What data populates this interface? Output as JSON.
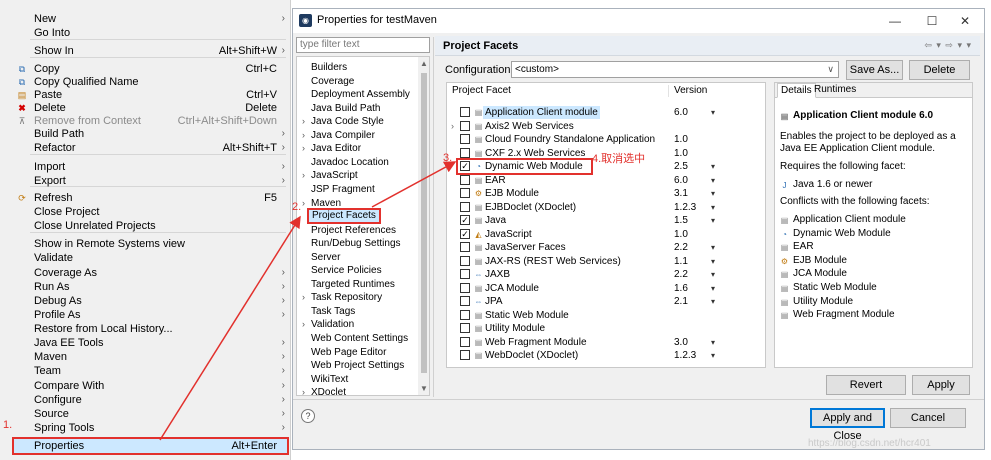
{
  "context_menu": {
    "items": [
      {
        "label": "New",
        "shortcut": "",
        "submenu": true,
        "icon": "",
        "disabled": false
      },
      {
        "label": "Go Into",
        "shortcut": "",
        "submenu": false,
        "icon": "",
        "disabled": false
      },
      {
        "label": "Show In",
        "shortcut": "Alt+Shift+W",
        "submenu": true,
        "icon": "",
        "disabled": false
      },
      {
        "label": "Copy",
        "shortcut": "Ctrl+C",
        "submenu": false,
        "icon": "copy-icon",
        "disabled": false
      },
      {
        "label": "Copy Qualified Name",
        "shortcut": "",
        "submenu": false,
        "icon": "copy-qualified-icon",
        "disabled": false
      },
      {
        "label": "Paste",
        "shortcut": "Ctrl+V",
        "submenu": false,
        "icon": "paste-icon",
        "disabled": false
      },
      {
        "label": "Delete",
        "shortcut": "Delete",
        "submenu": false,
        "icon": "delete-icon",
        "disabled": false
      },
      {
        "label": "Remove from Context",
        "shortcut": "Ctrl+Alt+Shift+Down",
        "submenu": false,
        "icon": "remove-context-icon",
        "disabled": true
      },
      {
        "label": "Build Path",
        "shortcut": "",
        "submenu": true,
        "icon": "",
        "disabled": false
      },
      {
        "label": "Refactor",
        "shortcut": "Alt+Shift+T",
        "submenu": true,
        "icon": "",
        "disabled": false
      },
      {
        "label": "Import",
        "shortcut": "",
        "submenu": true,
        "icon": "",
        "disabled": false
      },
      {
        "label": "Export",
        "shortcut": "",
        "submenu": true,
        "icon": "",
        "disabled": false
      },
      {
        "label": "Refresh",
        "shortcut": "F5",
        "submenu": false,
        "icon": "refresh-icon",
        "disabled": false
      },
      {
        "label": "Close Project",
        "shortcut": "",
        "submenu": false,
        "icon": "",
        "disabled": false
      },
      {
        "label": "Close Unrelated Projects",
        "shortcut": "",
        "submenu": false,
        "icon": "",
        "disabled": false
      },
      {
        "label": "Show in Remote Systems view",
        "shortcut": "",
        "submenu": false,
        "icon": "",
        "disabled": false
      },
      {
        "label": "Validate",
        "shortcut": "",
        "submenu": false,
        "icon": "",
        "disabled": false
      },
      {
        "label": "Coverage As",
        "shortcut": "",
        "submenu": true,
        "icon": "",
        "disabled": false
      },
      {
        "label": "Run As",
        "shortcut": "",
        "submenu": true,
        "icon": "",
        "disabled": false
      },
      {
        "label": "Debug As",
        "shortcut": "",
        "submenu": true,
        "icon": "",
        "disabled": false
      },
      {
        "label": "Profile As",
        "shortcut": "",
        "submenu": true,
        "icon": "",
        "disabled": false
      },
      {
        "label": "Restore from Local History...",
        "shortcut": "",
        "submenu": false,
        "icon": "",
        "disabled": false
      },
      {
        "label": "Java EE Tools",
        "shortcut": "",
        "submenu": true,
        "icon": "",
        "disabled": false
      },
      {
        "label": "Maven",
        "shortcut": "",
        "submenu": true,
        "icon": "",
        "disabled": false
      },
      {
        "label": "Team",
        "shortcut": "",
        "submenu": true,
        "icon": "",
        "disabled": false
      },
      {
        "label": "Compare With",
        "shortcut": "",
        "submenu": true,
        "icon": "",
        "disabled": false
      },
      {
        "label": "Configure",
        "shortcut": "",
        "submenu": true,
        "icon": "",
        "disabled": false
      },
      {
        "label": "Source",
        "shortcut": "",
        "submenu": true,
        "icon": "",
        "disabled": false
      },
      {
        "label": "Spring Tools",
        "shortcut": "",
        "submenu": true,
        "icon": "",
        "disabled": false
      },
      {
        "label": "Properties",
        "shortcut": "Alt+Enter",
        "submenu": false,
        "icon": "",
        "disabled": false
      }
    ]
  },
  "annotations": {
    "step1": "1.",
    "step2": "2.",
    "step3": "3.",
    "step4": "4.取消选中",
    "color": "#e2312d"
  },
  "dialog": {
    "title": "Properties for testMaven",
    "filter_placeholder": "type filter text",
    "tree": [
      {
        "label": "Builders",
        "expandable": false
      },
      {
        "label": "Coverage",
        "expandable": false
      },
      {
        "label": "Deployment Assembly",
        "expandable": false
      },
      {
        "label": "Java Build Path",
        "expandable": false
      },
      {
        "label": "Java Code Style",
        "expandable": true
      },
      {
        "label": "Java Compiler",
        "expandable": true
      },
      {
        "label": "Java Editor",
        "expandable": true
      },
      {
        "label": "Javadoc Location",
        "expandable": false
      },
      {
        "label": "JavaScript",
        "expandable": true
      },
      {
        "label": "JSP Fragment",
        "expandable": false
      },
      {
        "label": "Maven",
        "expandable": true
      },
      {
        "label": "Project Facets",
        "expandable": false
      },
      {
        "label": "Project References",
        "expandable": false
      },
      {
        "label": "Run/Debug Settings",
        "expandable": false
      },
      {
        "label": "Server",
        "expandable": false
      },
      {
        "label": "Service Policies",
        "expandable": false
      },
      {
        "label": "Targeted Runtimes",
        "expandable": false
      },
      {
        "label": "Task Repository",
        "expandable": true
      },
      {
        "label": "Task Tags",
        "expandable": false
      },
      {
        "label": "Validation",
        "expandable": true
      },
      {
        "label": "Web Content Settings",
        "expandable": false
      },
      {
        "label": "Web Page Editor",
        "expandable": false
      },
      {
        "label": "Web Project Settings",
        "expandable": false
      },
      {
        "label": "WikiText",
        "expandable": false
      },
      {
        "label": "XDoclet",
        "expandable": true
      }
    ],
    "page_title": "Project Facets",
    "configuration_label": "Configuration:",
    "configuration_value": "<custom>",
    "save_as": "Save As...",
    "delete": "Delete",
    "facet_col": "Project Facet",
    "version_col": "Version",
    "facets": [
      {
        "name": "Application Client module",
        "version": "6.0",
        "dropdown": true,
        "checked": false,
        "icon": "doc",
        "expandable": false
      },
      {
        "name": "Axis2 Web Services",
        "version": "",
        "dropdown": false,
        "checked": false,
        "icon": "doc",
        "expandable": true
      },
      {
        "name": "Cloud Foundry Standalone Application",
        "version": "1.0",
        "dropdown": false,
        "checked": false,
        "icon": "doc",
        "expandable": false
      },
      {
        "name": "CXF 2.x Web Services",
        "version": "1.0",
        "dropdown": false,
        "checked": false,
        "icon": "doc",
        "expandable": false
      },
      {
        "name": "Dynamic Web Module",
        "version": "2.5",
        "dropdown": true,
        "checked": true,
        "icon": "web",
        "expandable": false
      },
      {
        "name": "EAR",
        "version": "6.0",
        "dropdown": true,
        "checked": false,
        "icon": "doc",
        "expandable": false
      },
      {
        "name": "EJB Module",
        "version": "3.1",
        "dropdown": true,
        "checked": false,
        "icon": "ejb",
        "expandable": false
      },
      {
        "name": "EJBDoclet (XDoclet)",
        "version": "1.2.3",
        "dropdown": true,
        "checked": false,
        "icon": "doc",
        "expandable": false
      },
      {
        "name": "Java",
        "version": "1.5",
        "dropdown": true,
        "checked": true,
        "icon": "doc",
        "expandable": false
      },
      {
        "name": "JavaScript",
        "version": "1.0",
        "dropdown": false,
        "checked": true,
        "icon": "js",
        "expandable": false
      },
      {
        "name": "JavaServer Faces",
        "version": "2.2",
        "dropdown": true,
        "checked": false,
        "icon": "doc",
        "expandable": false
      },
      {
        "name": "JAX-RS (REST Web Services)",
        "version": "1.1",
        "dropdown": true,
        "checked": false,
        "icon": "doc",
        "expandable": false
      },
      {
        "name": "JAXB",
        "version": "2.2",
        "dropdown": true,
        "checked": false,
        "icon": "jaxb",
        "expandable": false
      },
      {
        "name": "JCA Module",
        "version": "1.6",
        "dropdown": true,
        "checked": false,
        "icon": "doc",
        "expandable": false
      },
      {
        "name": "JPA",
        "version": "2.1",
        "dropdown": true,
        "checked": false,
        "icon": "jaxb",
        "expandable": false
      },
      {
        "name": "Static Web Module",
        "version": "",
        "dropdown": false,
        "checked": false,
        "icon": "doc",
        "expandable": false
      },
      {
        "name": "Utility Module",
        "version": "",
        "dropdown": false,
        "checked": false,
        "icon": "doc",
        "expandable": false
      },
      {
        "name": "Web Fragment Module",
        "version": "3.0",
        "dropdown": true,
        "checked": false,
        "icon": "doc",
        "expandable": false
      },
      {
        "name": "WebDoclet (XDoclet)",
        "version": "1.2.3",
        "dropdown": true,
        "checked": false,
        "icon": "doc",
        "expandable": false
      }
    ],
    "details_tab": "Details",
    "runtimes_tab": "Runtimes",
    "detail_title": "Application Client module 6.0",
    "detail_desc1": "Enables the project to be deployed as a",
    "detail_desc2": "Java EE Application Client module.",
    "requires_label": "Requires the following facet:",
    "requires_item": "Java 1.6 or newer",
    "conflicts_label": "Conflicts with the following facets:",
    "conflicts": [
      {
        "name": "Application Client module",
        "icon": "doc"
      },
      {
        "name": "Dynamic Web Module",
        "icon": "web"
      },
      {
        "name": "EAR",
        "icon": "doc"
      },
      {
        "name": "EJB Module",
        "icon": "ejb"
      },
      {
        "name": "JCA Module",
        "icon": "doc"
      },
      {
        "name": "Static Web Module",
        "icon": "doc"
      },
      {
        "name": "Utility Module",
        "icon": "doc"
      },
      {
        "name": "Web Fragment Module",
        "icon": "doc"
      }
    ],
    "revert": "Revert",
    "apply": "Apply",
    "apply_close": "Apply and Close",
    "cancel": "Cancel",
    "help": "?"
  },
  "watermark": "https://blog.csdn.net/hcr401"
}
